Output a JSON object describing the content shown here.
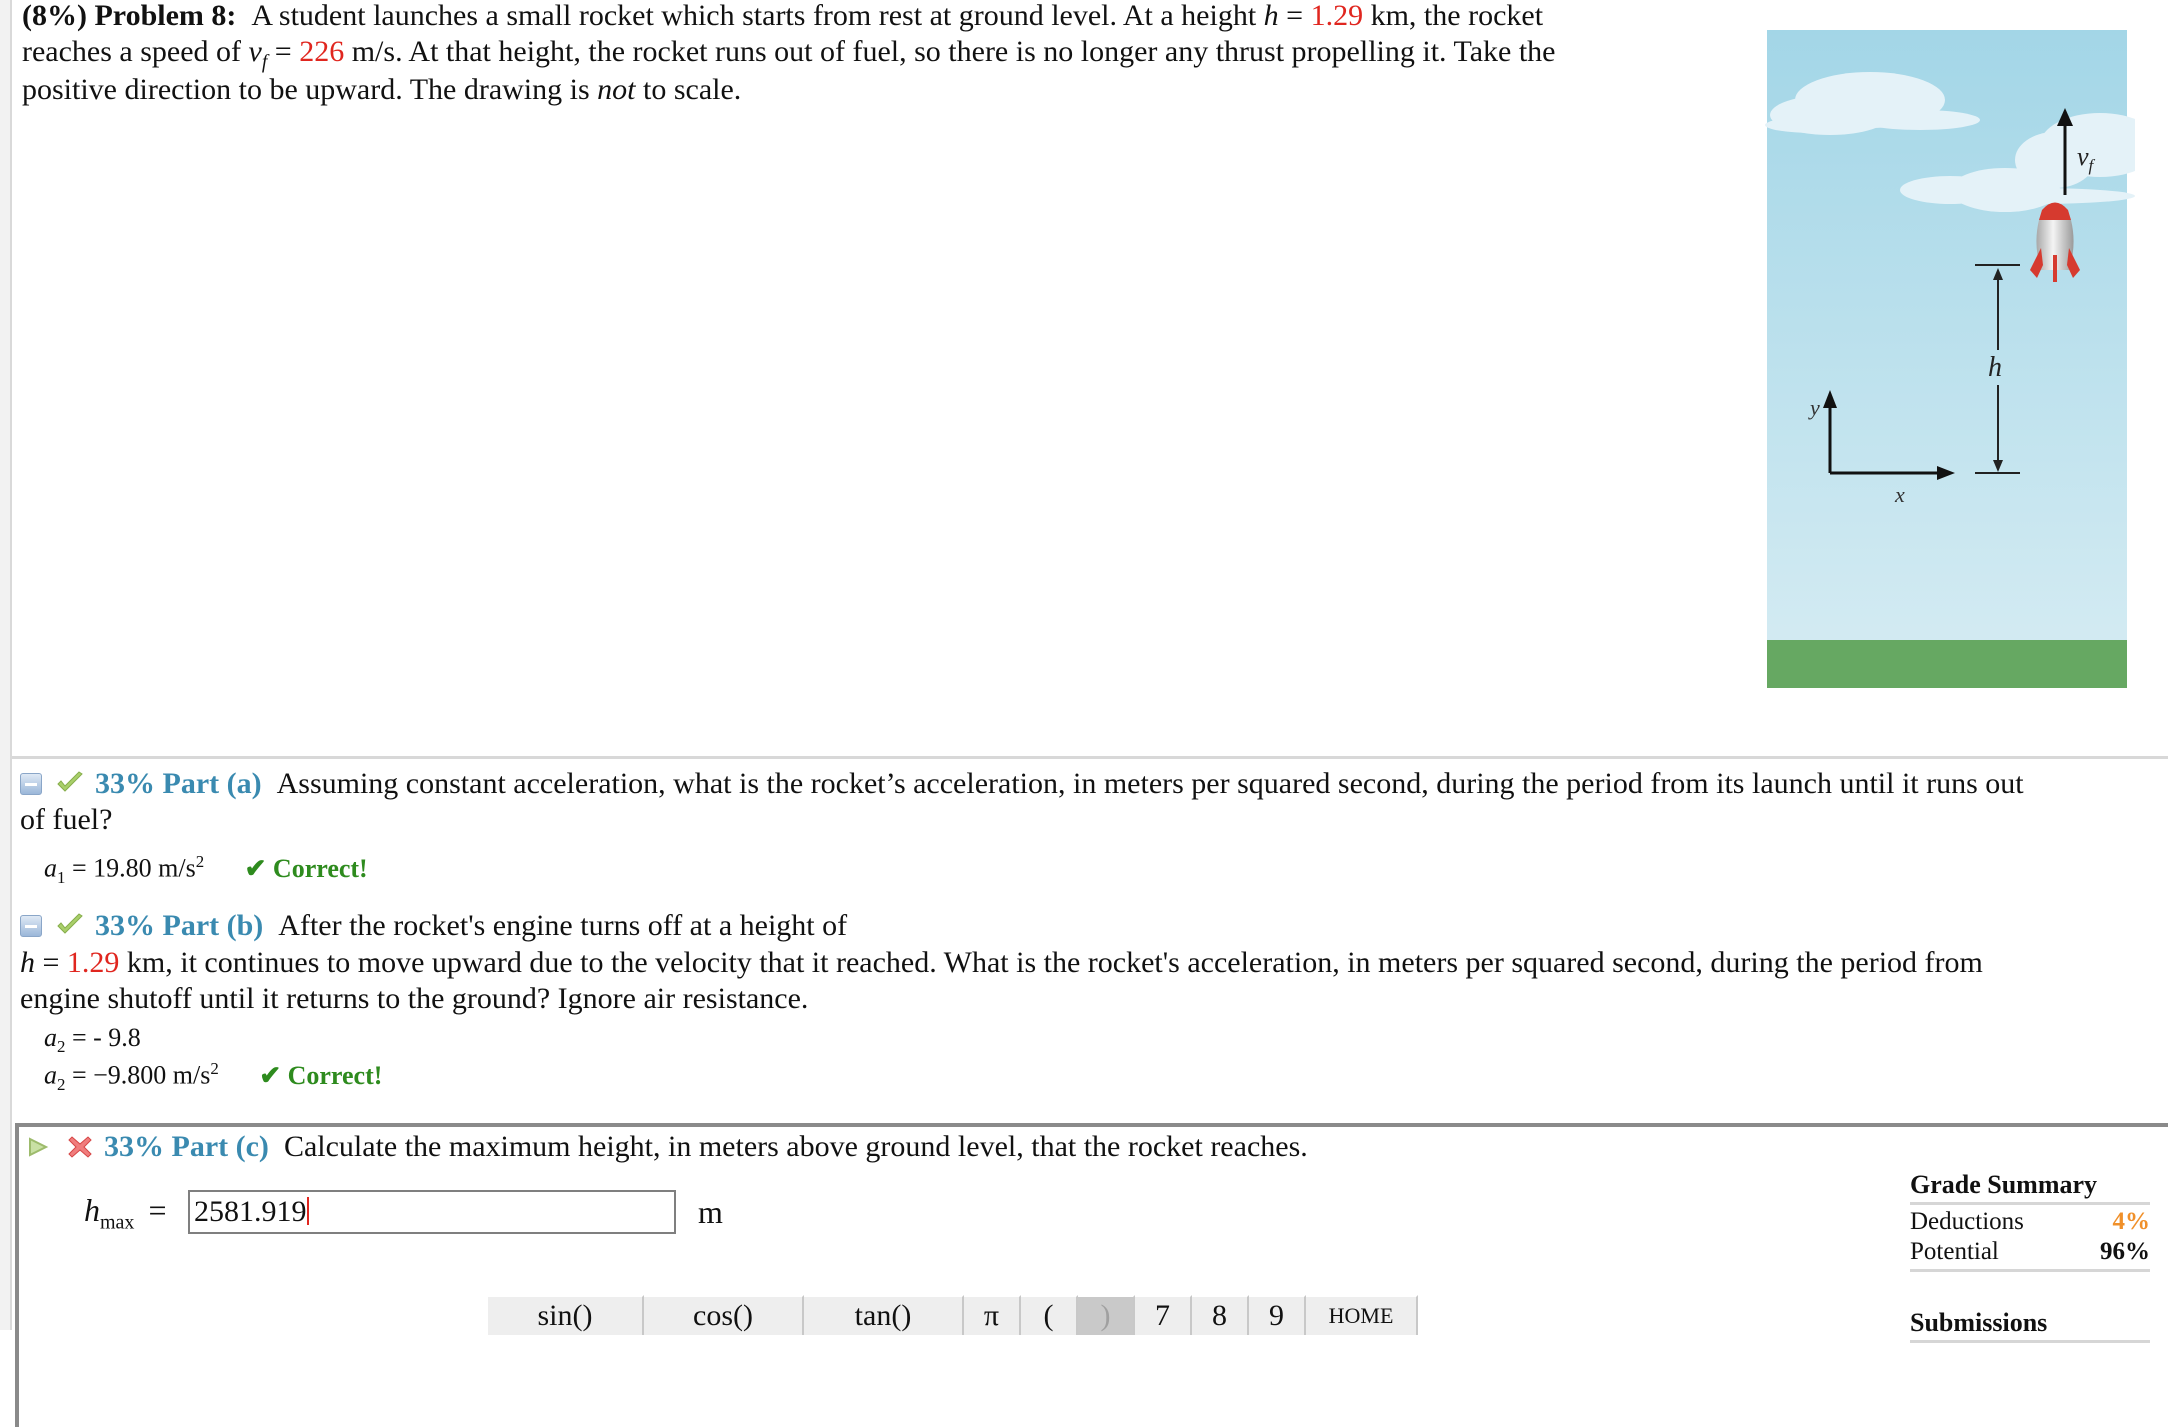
{
  "problem": {
    "weight": "(8%)",
    "label": "Problem 8:",
    "line1_text": "A student launches a small rocket which starts from rest at ground level. At a height",
    "h_symbol": "h",
    "equals": "=",
    "h_value": "1.29",
    "h_unit": "km, the rocket",
    "line2_start": "reaches a speed of",
    "vf_symbol": "v",
    "vf_sub": "f",
    "vf_value": "226",
    "line2_rest": "m/s. At that height, the rocket runs out of fuel, so there is no longer any thrust propelling it. Take the",
    "line3_start": "positive direction to be upward. The drawing is",
    "line3_italic": "not",
    "line3_end": "to scale."
  },
  "figure": {
    "label_vf": "v",
    "label_vf_sub": "f",
    "label_h": "h",
    "label_y": "y",
    "label_x": "x",
    "colors": {
      "sky_top": "#a5d8e8",
      "sky_bottom": "#d4ebf3",
      "grass": "#66a862",
      "rocket_red": "#d63a2f"
    }
  },
  "parts": {
    "a": {
      "percent": "33%",
      "label": "Part (a)",
      "question_line1": "Assuming constant acceleration, what is the rocket’s acceleration, in meters per squared second, during the period from its launch until it runs out",
      "question_line2": "of fuel?",
      "answer_symbol": "a",
      "answer_sub": "1",
      "answer_text": "= 19.80 m/s",
      "answer_sup": "2",
      "status": "✔ Correct!"
    },
    "b": {
      "percent": "33%",
      "label": "Part (b)",
      "question_line1": "After the rocket's engine turns off at a height of",
      "q2_h": "h",
      "q2_eq": "=",
      "q2_value": "1.29",
      "q2_rest": "km, it continues to move upward due to the velocity that it reached. What is the rocket's acceleration, in meters per squared second, during the period from",
      "question_line3": "engine shutoff until it returns to the ground? Ignore air resistance.",
      "entered_symbol": "a",
      "entered_sub": "2",
      "entered_text": "= - 9.8",
      "answer_symbol": "a",
      "answer_sub": "2",
      "answer_text": "= −9.800 m/s",
      "answer_sup": "2",
      "status": "✔ Correct!"
    },
    "c": {
      "percent": "33%",
      "label": "Part (c)",
      "question": "Calculate the maximum height, in meters above ground level, that the rocket reaches.",
      "var_symbol": "h",
      "var_sub": "max",
      "equals": "=",
      "input_value": "2581.919",
      "unit": "m"
    }
  },
  "keypad": {
    "keys": [
      "sin()",
      "cos()",
      "tan()",
      "π",
      "(",
      ")",
      "7",
      "8",
      "9",
      "HOME"
    ]
  },
  "grade_summary": {
    "title": "Grade Summary",
    "deductions_label": "Deductions",
    "deductions_value": "4%",
    "potential_label": "Potential",
    "potential_value": "96%",
    "submissions_title": "Submissions"
  },
  "colors": {
    "accent_blue": "#3a8ab0",
    "given_red": "#e0261f",
    "correct_green": "#2e8b1e",
    "deduction_orange": "#f0902a"
  }
}
